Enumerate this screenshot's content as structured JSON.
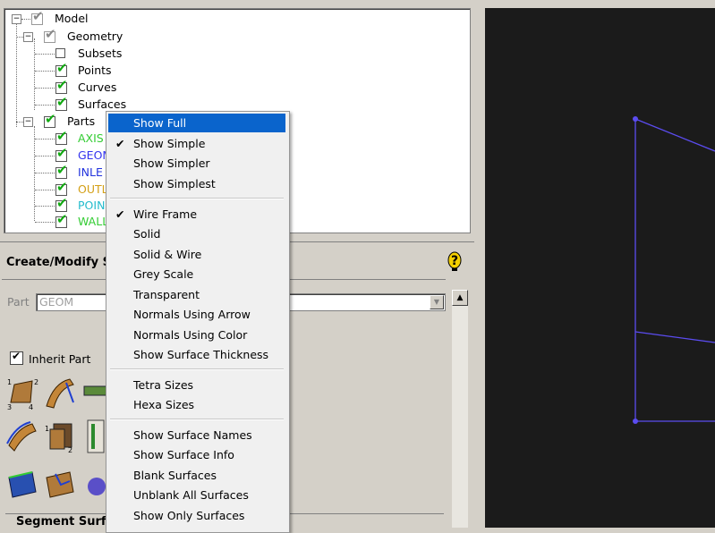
{
  "tree": {
    "model": "Model",
    "geometry": "Geometry",
    "subsets": "Subsets",
    "points": "Points",
    "curves": "Curves",
    "surfaces": "Surfaces",
    "parts": "Parts",
    "part_items": [
      {
        "label": "AXIS",
        "color": "#33cc33"
      },
      {
        "label": "GEOM",
        "color": "#3333ee"
      },
      {
        "label": "INLE",
        "color": "#2233dd"
      },
      {
        "label": "OUTL",
        "color": "#d4a017"
      },
      {
        "label": "POIN",
        "color": "#22bbcc"
      },
      {
        "label": "WALL",
        "color": "#33cc33"
      }
    ]
  },
  "panel": {
    "title": "Create/Modify S",
    "part_label": "Part",
    "part_value": "GEOM",
    "inherit_part": "Inherit Part",
    "segment_label": "Segment Surfa"
  },
  "menu": {
    "group1": [
      {
        "label": "Show Full",
        "selected": true,
        "checked": false
      },
      {
        "label": "Show Simple",
        "selected": false,
        "checked": true
      },
      {
        "label": "Show Simpler",
        "selected": false,
        "checked": false
      },
      {
        "label": "Show Simplest",
        "selected": false,
        "checked": false
      }
    ],
    "group2": [
      {
        "label": "Wire Frame",
        "checked": true
      },
      {
        "label": "Solid",
        "checked": false
      },
      {
        "label": "Solid & Wire",
        "checked": false
      },
      {
        "label": "Grey Scale",
        "checked": false
      },
      {
        "label": "Transparent",
        "checked": false
      },
      {
        "label": "Normals Using Arrow",
        "checked": false
      },
      {
        "label": "Normals Using Color",
        "checked": false
      },
      {
        "label": "Show Surface Thickness",
        "checked": false
      }
    ],
    "group3": [
      {
        "label": "Tetra Sizes"
      },
      {
        "label": "Hexa Sizes"
      }
    ],
    "group4": [
      {
        "label": "Show Surface Names"
      },
      {
        "label": "Show Surface Info"
      },
      {
        "label": "Blank Surfaces"
      },
      {
        "label": "Unblank All Surfaces"
      },
      {
        "label": "Show Only Surfaces"
      }
    ],
    "check_glyph": "✔"
  },
  "colors": {
    "viewport_bg": "#1b1b1b",
    "wire": "#5b4cf0",
    "menu_highlight": "#0a64cc",
    "check_green": "#11aa11"
  },
  "icons": {
    "help": "help-question-icon"
  }
}
